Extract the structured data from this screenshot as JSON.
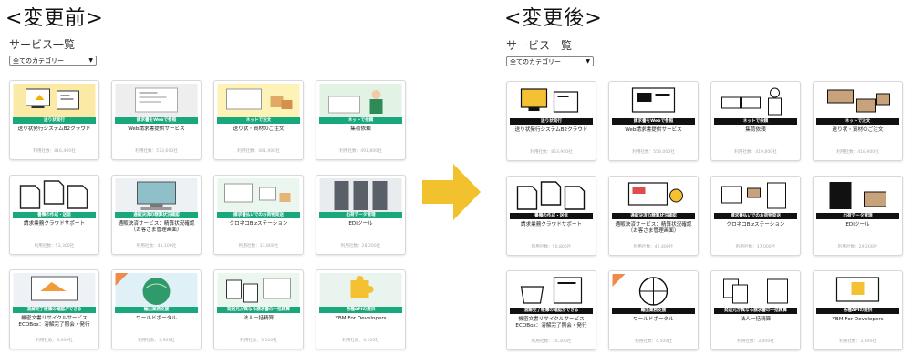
{
  "labels": {
    "before": "<変更前>",
    "after": "<変更後>"
  },
  "page": {
    "title": "サービス一覧",
    "category_select": "全てのカテゴリー"
  },
  "colors": {
    "before_band": "#19a77c",
    "after_band": "#111111",
    "arrow": "#f2c12e"
  },
  "before": {
    "cards": [
      {
        "band": "送り状発行",
        "name": "送り状発行システムB2クラウド",
        "count": "利用社数：816,400社",
        "icon": "monitor-printer-icon"
      },
      {
        "band": "請求書をWebで参照",
        "name": "Web請求書提供サービス",
        "count": "利用社数：573,600社",
        "icon": "web-invoice-icon"
      },
      {
        "band": "ネットで注文",
        "name": "送り状・資材のご注文",
        "count": "利用社数：401,900社",
        "icon": "boxes-icon"
      },
      {
        "band": "ネットで依頼",
        "name": "集荷依頼",
        "count": "利用社数：491,800社",
        "icon": "delivery-staff-icon"
      },
      {
        "band": "書類の作成・送信",
        "name": "請求業務クラウドサポート",
        "count": "利用社数：53,300社",
        "icon": "documents-icon"
      },
      {
        "band": "通販決済の精算状況確認",
        "name": "通販決済サービス：精算状況確認（お客さま管理画面）",
        "count": "利用社数：41,100社",
        "icon": "computer-icon"
      },
      {
        "band": "請求書払いでのお荷物発送",
        "name": "クロネコBizステーション",
        "count": "利用社数：33,800社",
        "icon": "shipping-icon"
      },
      {
        "band": "出荷データ管理",
        "name": "EDIツール",
        "count": "利用社数：28,200社",
        "icon": "server-icon"
      },
      {
        "band": "溶解完了帳簿の確認ができる",
        "name": "機密文書リサイクルサービスECOBox：溶解完了照会・発行",
        "count": "利用社数：9,000社",
        "icon": "monitor-icon"
      },
      {
        "band": "輸出業務支援",
        "name": "ワールドポータル",
        "count": "利用社数：3,900社",
        "icon": "globe-icon"
      },
      {
        "band": "発送元が異なる請求書の一括精算",
        "name": "法人一括精算",
        "count": "利用社数：3,100社",
        "icon": "invoices-icon"
      },
      {
        "band": "各種APIの提供",
        "name": "YBM For Developers",
        "count": "利用社数：3,100社",
        "icon": "puzzle-icon"
      }
    ]
  },
  "after": {
    "cards": [
      {
        "band": "送り状発行",
        "name": "送り状発行システムB2クラウド",
        "count": "利用社数：853,900社",
        "icon": "monitor-printer-icon"
      },
      {
        "band": "請求書をWebで参照",
        "name": "Web請求書提供サービス",
        "count": "利用社数：558,000社",
        "icon": "web-invoice-icon"
      },
      {
        "band": "ネットで依頼",
        "name": "集荷依頼",
        "count": "利用社数：419,800社",
        "icon": "delivery-staff-icon"
      },
      {
        "band": "ネットで注文",
        "name": "送り状・資材のご注文",
        "count": "利用社数：418,900社",
        "icon": "boxes-icon"
      },
      {
        "band": "書類の作成・送信",
        "name": "請求業務クラウドサポート",
        "count": "利用社数：50,800社",
        "icon": "documents-icon"
      },
      {
        "band": "通販決済の精算状況確認",
        "name": "通販決済サービス：精算状況確認（お客さま管理画面）",
        "count": "利用社数：42,400社",
        "icon": "computer-icon"
      },
      {
        "band": "請求書払いでのお荷物発送",
        "name": "クロネコBizステーション",
        "count": "利用社数：37,000社",
        "icon": "shipping-icon"
      },
      {
        "band": "出荷データ管理",
        "name": "EDIツール",
        "count": "利用社数：29,200社",
        "icon": "server-icon"
      },
      {
        "band": "溶解完了帳簿の確認ができる",
        "name": "機密文書リサイクルサービスECOBox：溶解完了照会・発行",
        "count": "利用社数：10,300社",
        "icon": "monitor-icon"
      },
      {
        "band": "輸出業務支援",
        "name": "ワールドポータル",
        "count": "利用社数：4,500社",
        "icon": "globe-icon"
      },
      {
        "band": "発送元が異なる請求書の一括精算",
        "name": "法人一括精算",
        "count": "利用社数：3,400社",
        "icon": "invoices-icon"
      },
      {
        "band": "各種APIの提供",
        "name": "YBM For Developers",
        "count": "利用社数：3,300社",
        "icon": "puzzle-icon"
      }
    ]
  }
}
